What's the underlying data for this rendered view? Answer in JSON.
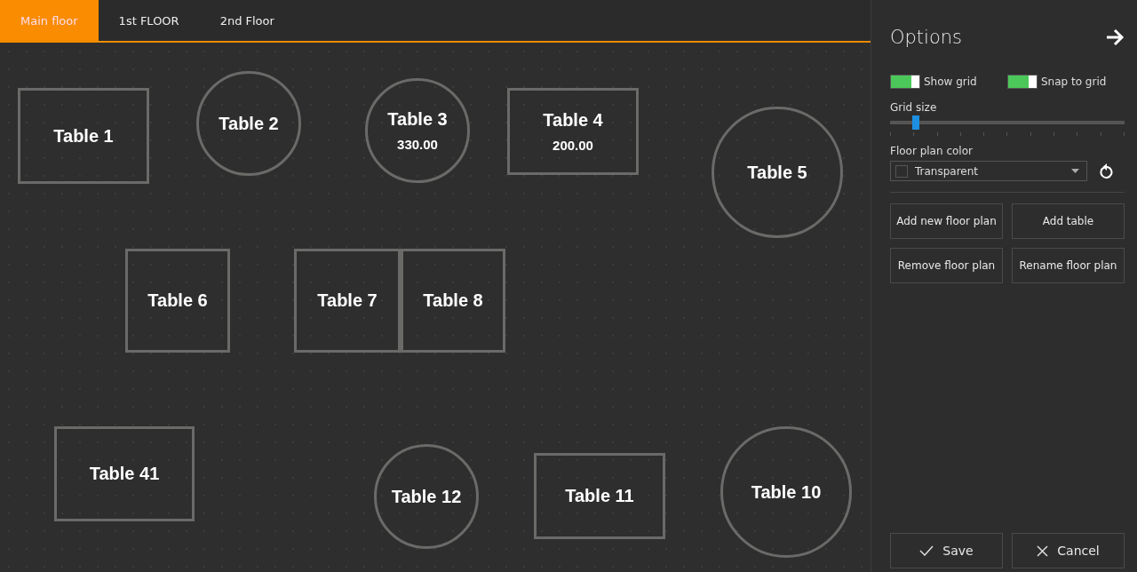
{
  "tabs": [
    {
      "label": "Main floor",
      "selected": true
    },
    {
      "label": "1st FLOOR",
      "selected": false
    },
    {
      "label": "2nd Floor",
      "selected": false
    }
  ],
  "tables": [
    {
      "name": "Table 1",
      "kind": "rect"
    },
    {
      "name": "Table 2",
      "kind": "circle"
    },
    {
      "name": "Table 3",
      "kind": "circle",
      "amount": "330.00"
    },
    {
      "name": "Table 4",
      "kind": "rect",
      "amount": "200.00"
    },
    {
      "name": "Table 5",
      "kind": "circle"
    },
    {
      "name": "Table 6",
      "kind": "rect"
    },
    {
      "name": "Table 7",
      "kind": "rect"
    },
    {
      "name": "Table 8",
      "kind": "rect"
    },
    {
      "name": "Table 41",
      "kind": "rect"
    },
    {
      "name": "Table 12",
      "kind": "circle"
    },
    {
      "name": "Table 11",
      "kind": "rect"
    },
    {
      "name": "Table 10",
      "kind": "circle"
    }
  ],
  "options": {
    "title": "Options",
    "toggles": [
      {
        "label": "Show grid",
        "on": true
      },
      {
        "label": "Snap to grid",
        "on": true
      }
    ],
    "grid_size": {
      "label": "Grid size",
      "level": 0.11
    },
    "floor_plan_color": {
      "label": "Floor plan color",
      "value": "Transparent"
    },
    "actions": [
      "Add new floor plan",
      "Add table",
      "Remove floor plan",
      "Rename floor plan"
    ],
    "footer": [
      {
        "label": "Save",
        "kind": "save"
      },
      {
        "label": "Cancel",
        "kind": "cancel"
      }
    ]
  }
}
